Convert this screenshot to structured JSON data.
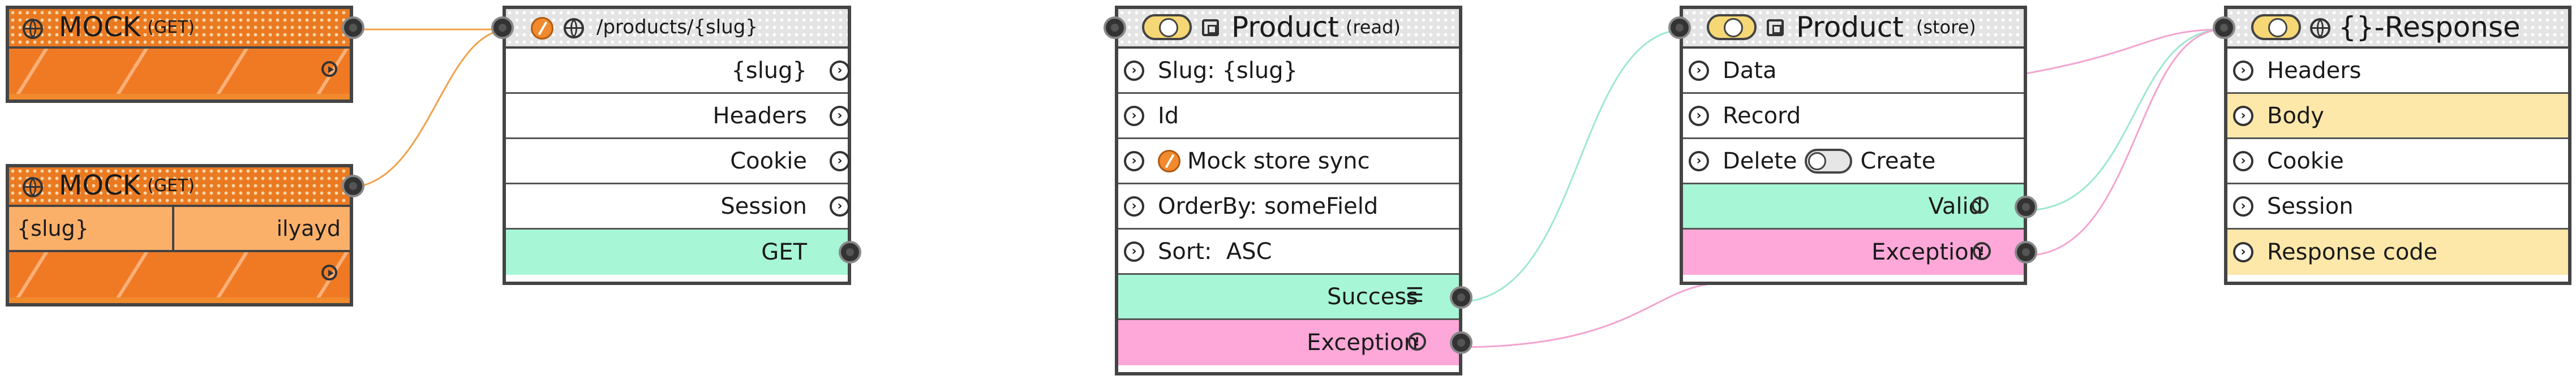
{
  "mock1": {
    "title": "MOCK",
    "method": "(GET)"
  },
  "mock2": {
    "title": "MOCK",
    "method": "(GET)",
    "param_name": "{slug}",
    "param_value": "ilyayd"
  },
  "endpoint": {
    "path": "/products/{slug}",
    "rows": [
      "{slug}",
      "Headers",
      "Cookie",
      "Session",
      "GET"
    ]
  },
  "product_read": {
    "title": "Product",
    "subtitle": "(read)",
    "rows": [
      "Slug: {slug}",
      "Id",
      "Mock store sync",
      "OrderBy: someField",
      "Sort:  ASC"
    ],
    "success": "Success",
    "exception": "Exception"
  },
  "product_store": {
    "title": "Product",
    "subtitle": "(store)",
    "rows": [
      "Data",
      "Record"
    ],
    "delete_label": "Delete",
    "create_label": "Create",
    "valid": "Valid",
    "exception": "Exception"
  },
  "response": {
    "title": "{}-Response",
    "rows": [
      "Headers",
      "Body",
      "Cookie",
      "Session",
      "Response code"
    ]
  },
  "colors": {
    "wire_orange": "#f0a24a",
    "wire_green": "#9ee8cf",
    "wire_pink": "#f3a4cf",
    "green": "#a7f6d6",
    "pink": "#fda8d8",
    "yellow": "#fde8a9",
    "orange": "#f08a2c"
  }
}
